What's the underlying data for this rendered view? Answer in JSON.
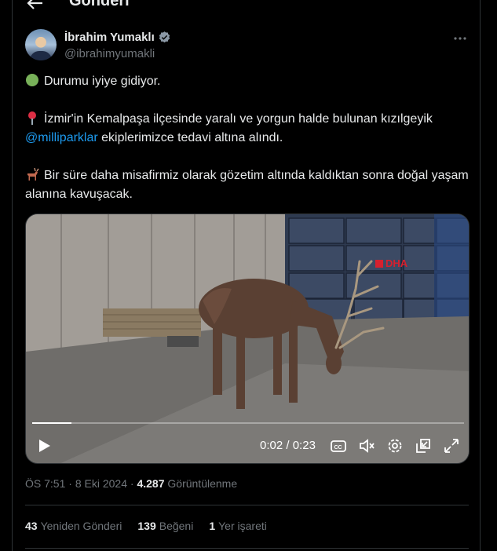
{
  "header": {
    "title": "Gönderi",
    "back_icon": "arrow-left-icon"
  },
  "author": {
    "name": "İbrahim Yumaklı",
    "handle": "@ibrahimyumakli",
    "verified_icon": "verified-badge-icon",
    "more_icon": "more-horizontal-icon"
  },
  "tweet": {
    "line1_emoji": "green-circle-icon",
    "line1": "Durumu iyiye gidiyor.",
    "para2_emoji": "round-pushpin-icon",
    "para2_a": "İzmir'in Kemalpaşa ilçesinde yaralı ve yorgun halde bulunan kızılgeyik",
    "para2_mention": "@milliparklar",
    "para2_b": " ekiplerimizce tedavi altına alındı.",
    "para3_emoji": "deer-icon",
    "para3": "Bir süre daha misafirmiz olarak gözetim altında kaldıktan sonra doğal yaşam alanına kavuşacak."
  },
  "video": {
    "watermark": "DHA",
    "current_time": "0:02",
    "separator": " / ",
    "duration": "0:23",
    "progress": 0.09,
    "icons": [
      "play-icon",
      "captions-icon",
      "mute-icon",
      "settings-icon",
      "pop-out-icon",
      "fullscreen-icon"
    ]
  },
  "meta": {
    "time": "ÖS 7:51",
    "dot": " · ",
    "date": "8 Eki 2024",
    "views": "4.287",
    "views_label": "Görüntülenme"
  },
  "stats": {
    "reposts": "43",
    "reposts_label": "Yeniden Gönderi",
    "likes": "139",
    "likes_label": "Beğeni",
    "bookmarks": "1",
    "bookmarks_label": "Yer işareti"
  },
  "colors": {
    "background": "#000000",
    "text": "#e7e9ea",
    "muted": "#71767b",
    "accent": "#1d9bf0",
    "border": "#2f3336"
  }
}
